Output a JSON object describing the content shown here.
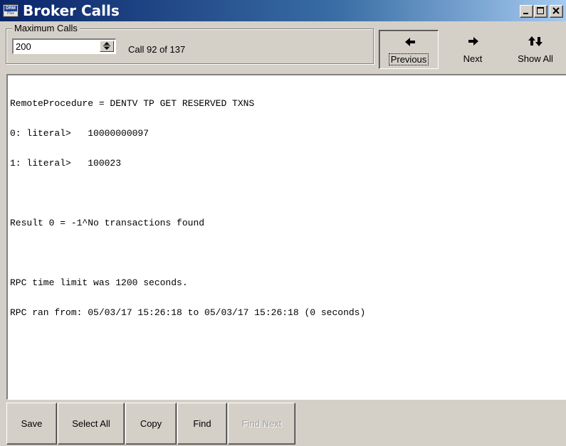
{
  "window": {
    "title": "Broker Calls",
    "icon_name": "drm-app-icon",
    "icon_text_top": "DRM",
    "icon_text_bottom": "Plus",
    "controls": [
      "minimize",
      "maximize",
      "close"
    ]
  },
  "toolbar": {
    "group_label": "Maximum Calls",
    "max_calls_value": "200",
    "call_counter": "Call 92 of 137",
    "buttons": [
      {
        "label": "Previous",
        "icon": "arrow-left-icon",
        "pressed": true
      },
      {
        "label": "Next",
        "icon": "arrow-right-icon",
        "pressed": false
      },
      {
        "label": "Show All",
        "icon": "arrows-up-down-icon",
        "pressed": false
      }
    ]
  },
  "log": {
    "lines": [
      "RemoteProcedure = DENTV TP GET RESERVED TXNS",
      "0: literal>   10000000097",
      "1: literal>   100023",
      "",
      "Result 0 = -1^No transactions found",
      "",
      "RPC time limit was 1200 seconds.",
      "RPC ran from: 05/03/17 15:26:18 to 05/03/17 15:26:18 (0 seconds)"
    ]
  },
  "bottom_buttons": [
    {
      "label": "Save",
      "enabled": true
    },
    {
      "label": "Select All",
      "enabled": true
    },
    {
      "label": "Copy",
      "enabled": true
    },
    {
      "label": "Find",
      "enabled": true
    },
    {
      "label": "Find Next",
      "enabled": false
    }
  ],
  "colors": {
    "titlebar_start": "#0a246a",
    "titlebar_end": "#a6caf0",
    "face": "#d4d0c8"
  }
}
